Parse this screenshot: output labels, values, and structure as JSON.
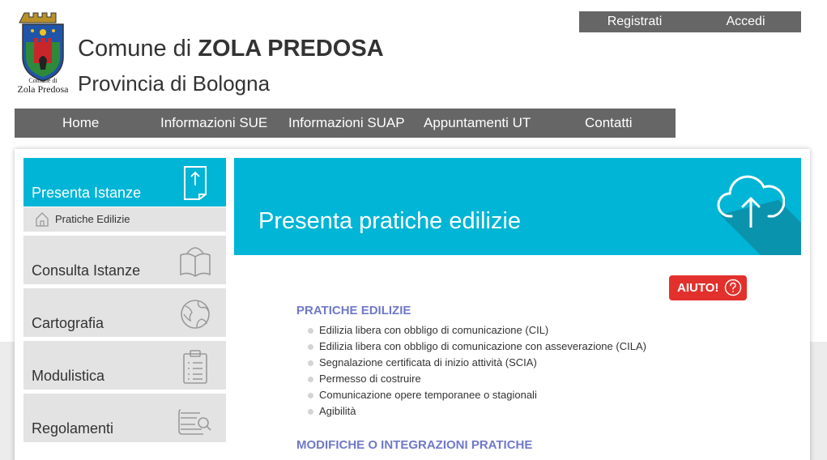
{
  "header": {
    "logo_text_line1": "Comune di",
    "logo_text_line2": "Zola Predosa",
    "title_prefix": "Comune di",
    "title_strong": "ZOLA PREDOSA",
    "subtitle": "Provincia di Bologna"
  },
  "auth": {
    "register": "Registrati",
    "login": "Accedi"
  },
  "nav": {
    "items": [
      "Home",
      "Informazioni SUE",
      "Informazioni SUAP",
      "Appuntamenti UT",
      "Contatti"
    ]
  },
  "sidebar": {
    "items": [
      {
        "label": "Presenta Istanze",
        "icon": "document-icon"
      },
      {
        "label": "Consulta Istanze",
        "icon": "open-book-icon"
      },
      {
        "label": "Cartografia",
        "icon": "globe-icon"
      },
      {
        "label": "Modulistica",
        "icon": "clipboard-list-icon"
      },
      {
        "label": "Regolamenti",
        "icon": "search-document-icon"
      }
    ],
    "sub": {
      "label": "Pratiche Edilizie",
      "icon": "home-icon"
    }
  },
  "banner": {
    "title": "Presenta pratiche edilizie",
    "icon": "cloud-upload-icon"
  },
  "help": {
    "label": "AIUTO!",
    "icon": "question-circle-icon"
  },
  "content": {
    "section1": "PRATICHE EDILIZIE",
    "items": [
      "Edilizia libera con obbligo di comunicazione (CIL)",
      "Edilizia libera con obbligo di comunicazione con asseverazione (CILA)",
      "Segnalazione certificata di inizio attività (SCIA)",
      "Permesso di costruire",
      "Comunicazione opere temporanee o stagionali",
      "Agibilità"
    ],
    "section2": "MODIFICHE O INTEGRAZIONI PRATICHE"
  },
  "colors": {
    "accent": "#00b5d6",
    "nav": "#666666",
    "help": "#e2312c",
    "section": "#6f79c7"
  }
}
